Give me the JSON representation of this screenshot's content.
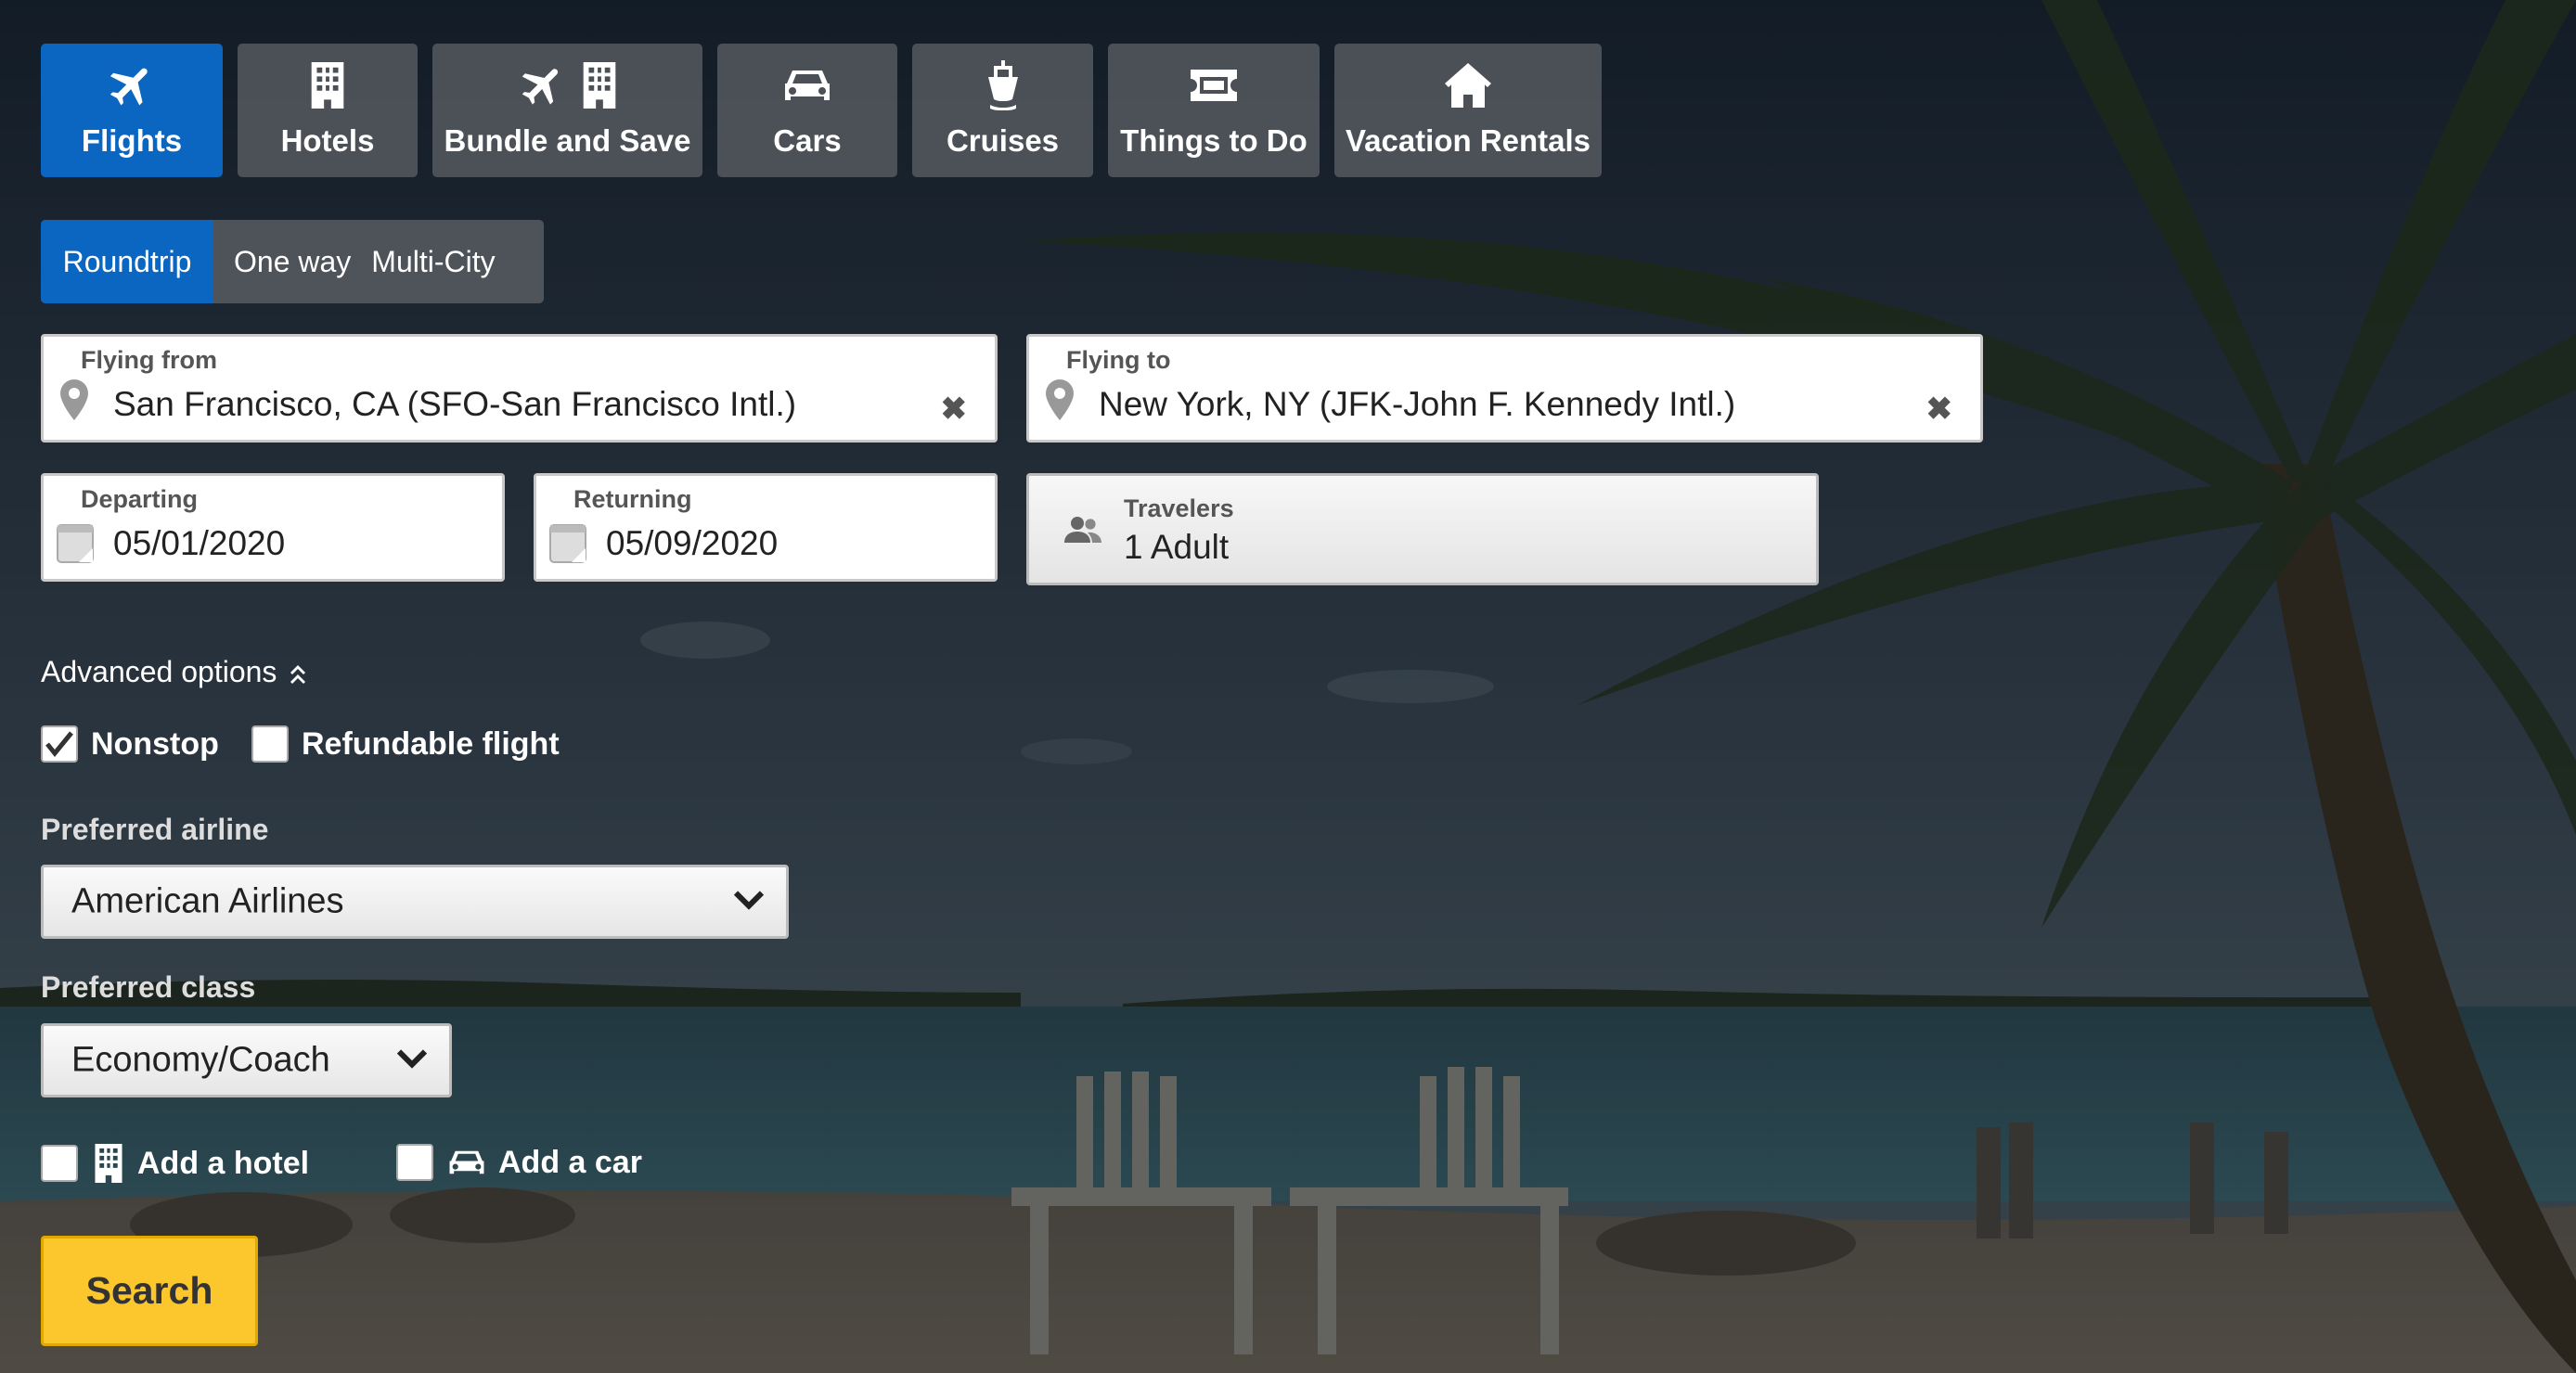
{
  "product_tabs": [
    {
      "label": "Flights",
      "icon": "plane-icon",
      "active": true
    },
    {
      "label": "Hotels",
      "icon": "building-icon",
      "active": false
    },
    {
      "label": "Bundle and Save",
      "icon": "plane-building-icon",
      "active": false
    },
    {
      "label": "Cars",
      "icon": "car-icon",
      "active": false
    },
    {
      "label": "Cruises",
      "icon": "ship-icon",
      "active": false
    },
    {
      "label": "Things to Do",
      "icon": "ticket-icon",
      "active": false
    },
    {
      "label": "Vacation Rentals",
      "icon": "house-icon",
      "active": false
    }
  ],
  "trip_type": {
    "options": [
      "Roundtrip",
      "One way",
      "Multi-City"
    ],
    "selected": "Roundtrip"
  },
  "flying_from": {
    "label": "Flying from",
    "value": "San Francisco, CA (SFO-San Francisco Intl.)",
    "clear_icon": "✖"
  },
  "flying_to": {
    "label": "Flying to",
    "value": "New York, NY (JFK-John F. Kennedy Intl.)",
    "clear_icon": "✖"
  },
  "departing": {
    "label": "Departing",
    "value": "05/01/2020"
  },
  "returning": {
    "label": "Returning",
    "value": "05/09/2020"
  },
  "travelers": {
    "label": "Travelers",
    "value": "1 Adult"
  },
  "advanced_options": {
    "label": "Advanced options",
    "expanded": true
  },
  "filters": {
    "nonstop": {
      "label": "Nonstop",
      "checked": true
    },
    "refundable": {
      "label": "Refundable flight",
      "checked": false
    }
  },
  "preferred_airline": {
    "label": "Preferred airline",
    "value": "American Airlines"
  },
  "preferred_class": {
    "label": "Preferred class",
    "value": "Economy/Coach"
  },
  "add_hotel": {
    "label": "Add a hotel",
    "checked": false
  },
  "add_car": {
    "label": "Add a car",
    "checked": false
  },
  "search_button": {
    "label": "Search"
  },
  "colors": {
    "accent": "#0b66c2",
    "search": "#fcc62d"
  }
}
